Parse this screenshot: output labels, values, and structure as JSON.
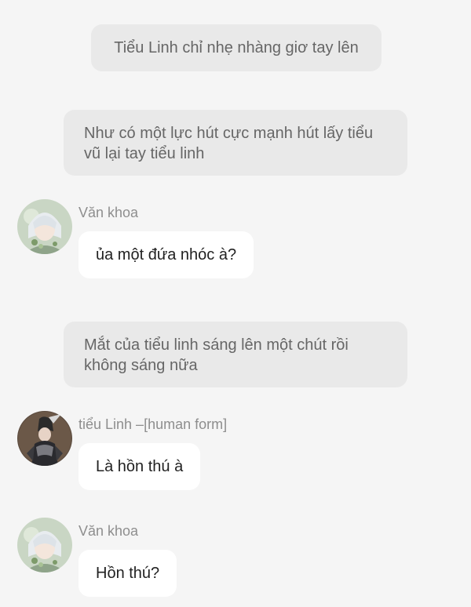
{
  "messages": [
    {
      "type": "narration",
      "text": "Tiểu Linh chỉ nhẹ nhàng giơ tay lên"
    },
    {
      "type": "narration",
      "text": "Như có một lực hút cực mạnh hút lấy tiểu vũ lại tay tiểu linh"
    },
    {
      "type": "chat",
      "sender": "Văn khoa",
      "avatar": "white-haired-character-avatar",
      "text": "ủa một đứa nhóc à?"
    },
    {
      "type": "narration",
      "text": "Mắt của tiểu linh sáng lên một chút rồi không sáng nữa"
    },
    {
      "type": "chat",
      "sender": "tiểu Linh –[human form]",
      "avatar": "dark-armored-character-avatar",
      "text": "Là hồn thú à"
    },
    {
      "type": "chat",
      "sender": "Văn khoa",
      "avatar": "white-haired-character-avatar",
      "text": "Hồn thú?"
    }
  ],
  "colors": {
    "background": "#f5f5f5",
    "narration_bg": "#e9e9e9",
    "narration_text": "#666666",
    "bubble_bg": "#ffffff",
    "sender_text": "#8e8e8e"
  }
}
